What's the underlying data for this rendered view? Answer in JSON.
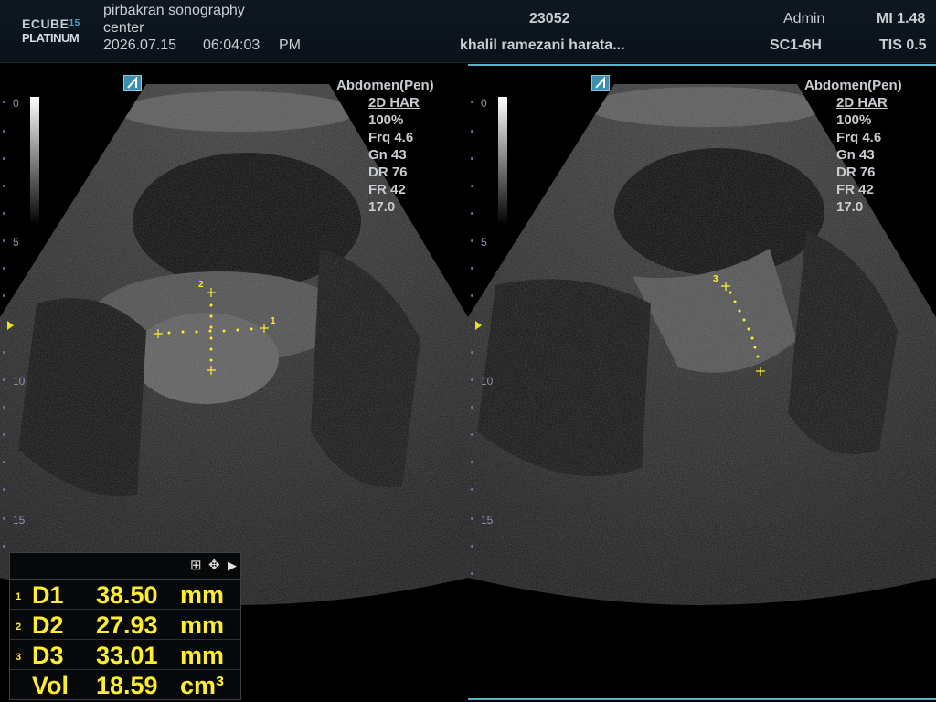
{
  "header": {
    "logo_top": "ECUBE",
    "logo_num": "15",
    "logo_bottom": "PLATINUM",
    "institution_line1": "pirbakran sonography",
    "institution_line2": "center",
    "date": "2026.07.15",
    "time": "06:04:03",
    "ampm": "PM",
    "patient_id": "23052",
    "patient_name": "khalil ramezani harata...",
    "operator": "Admin",
    "probe": "SC1-6H",
    "mi": "MI 1.48",
    "tis": "TIS 0.5"
  },
  "left_pane": {
    "params": {
      "preset": "Abdomen(Pen)",
      "mode": "2D HAR",
      "power": "100%",
      "frq": "Frq 4.6",
      "gain": "Gn 43",
      "dr": "DR 76",
      "fr": "FR 42",
      "depth": "17.0"
    },
    "depth_labels": [
      "0",
      "5",
      "10",
      "15"
    ],
    "calipers": [
      "1",
      "2"
    ]
  },
  "right_pane": {
    "params": {
      "preset": "Abdomen(Pen)",
      "mode": "2D HAR",
      "power": "100%",
      "frq": "Frq 4.6",
      "gain": "Gn 43",
      "dr": "DR 76",
      "fr": "FR 42",
      "depth": "17.0"
    },
    "depth_labels": [
      "0",
      "5",
      "10",
      "15"
    ],
    "calipers": [
      "3"
    ]
  },
  "measurements": [
    {
      "index": "1",
      "name": "D1",
      "value": "38.50",
      "unit": "mm"
    },
    {
      "index": "2",
      "name": "D2",
      "value": "27.93",
      "unit": "mm"
    },
    {
      "index": "3",
      "name": "D3",
      "value": "33.01",
      "unit": "mm"
    },
    {
      "index": "",
      "name": "Vol",
      "value": "18.59",
      "unit": "cm³"
    }
  ],
  "measurement_tools": {
    "grid_icon": "⊞",
    "move_icon": "✥",
    "expand_icon": "▶"
  },
  "colors": {
    "caliper": "#ffee30",
    "accent": "#5bb0c8"
  }
}
